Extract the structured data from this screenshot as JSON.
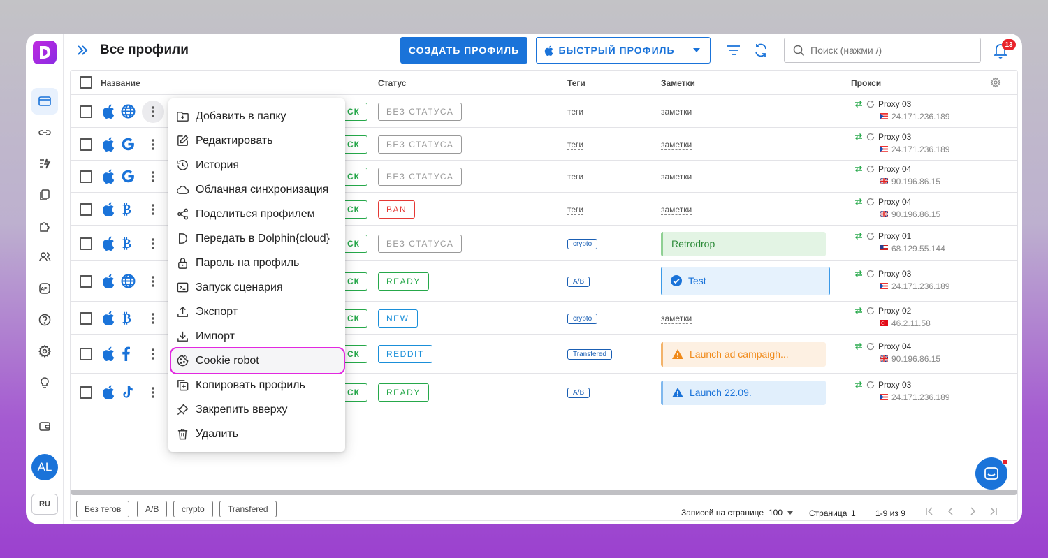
{
  "header": {
    "title": "Все профили",
    "create_label": "СОЗДАТЬ ПРОФИЛЬ",
    "quick_label": "БЫСТРЫЙ ПРОФИЛЬ",
    "search_placeholder": "Поиск (нажми /)",
    "notifications": "13"
  },
  "sidebar": {
    "items": [
      "profiles-icon",
      "link-icon",
      "automation-icon",
      "copy-icon",
      "puzzle-icon",
      "users-icon",
      "api-icon",
      "help-icon",
      "settings-icon",
      "bulb-icon",
      "wallet-icon"
    ],
    "avatar": "AL",
    "lang": "RU"
  },
  "table": {
    "columns": {
      "name": "Название",
      "status": "Статус",
      "tags": "Теги",
      "notes": "Заметки",
      "proxy": "Прокси"
    },
    "start_label": "СК",
    "rows": [
      {
        "os": "apple",
        "browser": "globe",
        "status": "БЕЗ СТАТУСА",
        "status_color": "#999999",
        "tag": "теги",
        "tag_chip": false,
        "note": "заметки",
        "note_type": "link",
        "proxy": "Proxy 03",
        "ip": "24.171.236.189",
        "flag": "pr"
      },
      {
        "os": "apple",
        "browser": "google",
        "status": "БЕЗ СТАТУСА",
        "status_color": "#999999",
        "tag": "теги",
        "tag_chip": false,
        "note": "заметки",
        "note_type": "link",
        "proxy": "Proxy 03",
        "ip": "24.171.236.189",
        "flag": "pr"
      },
      {
        "os": "apple",
        "browser": "google",
        "status": "БЕЗ СТАТУСА",
        "status_color": "#999999",
        "tag": "теги",
        "tag_chip": false,
        "note": "заметки",
        "note_type": "link",
        "proxy": "Proxy 04",
        "ip": "90.196.86.15",
        "flag": "uk"
      },
      {
        "os": "apple",
        "browser": "bitcoin",
        "status": "BAN",
        "status_color": "#e53935",
        "tag": "теги",
        "tag_chip": false,
        "note": "заметки",
        "note_type": "link",
        "proxy": "Proxy 04",
        "ip": "90.196.86.15",
        "flag": "uk"
      },
      {
        "os": "apple",
        "browser": "bitcoin",
        "status": "БЕЗ СТАТУСА",
        "status_color": "#999999",
        "tag": "crypto",
        "tag_chip": true,
        "note": "Retrodrop",
        "note_type": "green",
        "proxy": "Proxy 01",
        "ip": "68.129.55.144",
        "flag": "us"
      },
      {
        "os": "apple",
        "browser": "globe",
        "status": "READY",
        "status_color": "#26a84a",
        "tag": "A/B",
        "tag_chip": true,
        "note": "Test",
        "note_type": "blue-check",
        "proxy": "Proxy 03",
        "ip": "24.171.236.189",
        "flag": "pr"
      },
      {
        "os": "apple",
        "browser": "bitcoin",
        "status": "NEW",
        "status_color": "#1a8fd9",
        "tag": "crypto",
        "tag_chip": true,
        "note": "заметки",
        "note_type": "link",
        "proxy": "Proxy 02",
        "ip": "46.2.11.58",
        "flag": "tr"
      },
      {
        "os": "apple",
        "browser": "facebook",
        "status": "REDDIT",
        "status_color": "#1a8fd9",
        "tag": "Transfered",
        "tag_chip": true,
        "note": "Launch ad campaigh...",
        "note_type": "orange",
        "proxy": "Proxy 04",
        "ip": "90.196.86.15",
        "flag": "uk"
      },
      {
        "os": "apple",
        "browser": "tiktok",
        "status": "READY",
        "status_color": "#26a84a",
        "tag": "A/B",
        "tag_chip": true,
        "note": "Launch 22.09.",
        "note_type": "blue-warn",
        "proxy": "Proxy 03",
        "ip": "24.171.236.189",
        "flag": "pr"
      }
    ]
  },
  "menu": {
    "items": [
      {
        "label": "Добавить в папку",
        "icon": "folder-plus-icon"
      },
      {
        "label": "Редактировать",
        "icon": "edit-icon"
      },
      {
        "label": "История",
        "icon": "history-icon"
      },
      {
        "label": "Облачная синхронизация",
        "icon": "cloud-icon"
      },
      {
        "label": "Поделиться профилем",
        "icon": "share-icon"
      },
      {
        "label": "Передать в Dolphin{cloud}",
        "icon": "dolphin-icon"
      },
      {
        "label": "Пароль на профиль",
        "icon": "lock-icon"
      },
      {
        "label": "Запуск сценария",
        "icon": "terminal-icon"
      },
      {
        "label": "Экспорт",
        "icon": "export-icon"
      },
      {
        "label": "Импорт",
        "icon": "import-icon"
      },
      {
        "label": "Cookie robot",
        "icon": "cookie-icon"
      },
      {
        "label": "Копировать профиль",
        "icon": "copy-profile-icon"
      },
      {
        "label": "Закрепить вверху",
        "icon": "pin-icon"
      },
      {
        "label": "Удалить",
        "icon": "trash-icon"
      }
    ],
    "highlighted_index": 10
  },
  "footer": {
    "tags": [
      "Без тегов",
      "A/B",
      "crypto",
      "Transfered"
    ],
    "per_page_label": "Записей на странице",
    "per_page_value": "100",
    "page_label": "Страница",
    "page_value": "1",
    "range": "1-9 из 9"
  },
  "colors": {
    "accent": "#1a73d9",
    "brand": "#b02ae0",
    "highlight": "#e229e0"
  }
}
